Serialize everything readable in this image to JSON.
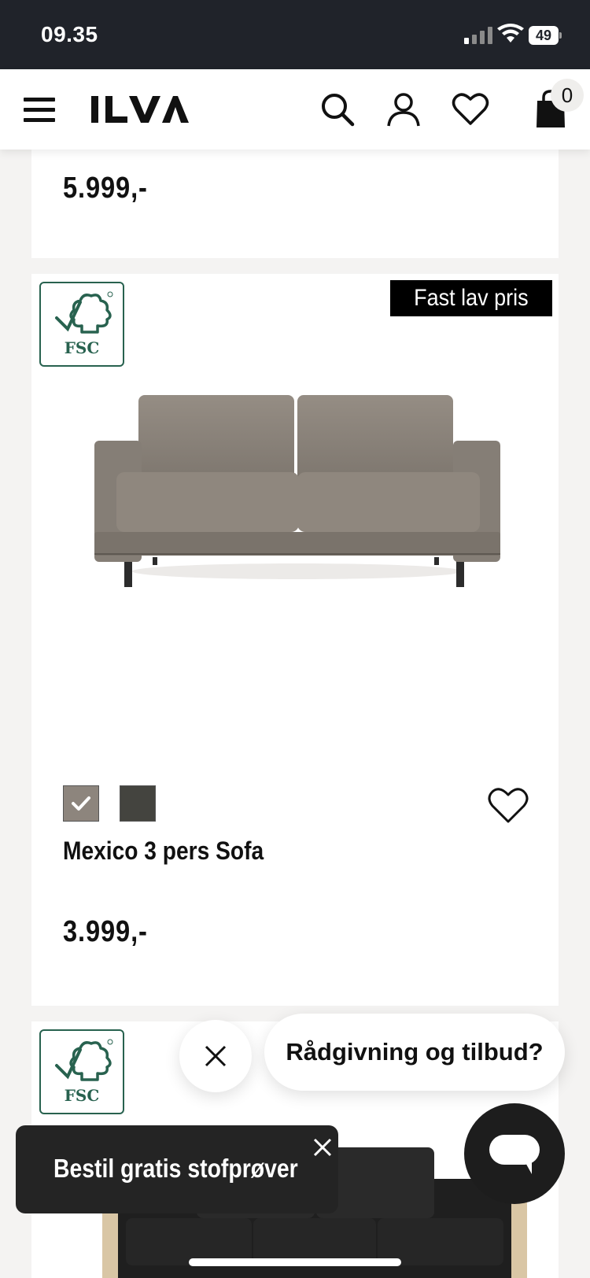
{
  "status_bar": {
    "time": "09.35",
    "battery": "49"
  },
  "header": {
    "logo_text": "ILVA",
    "icons": [
      "menu-icon",
      "search-icon",
      "user-icon",
      "heart-icon",
      "shopping-bag-icon"
    ],
    "cart_count": "0"
  },
  "products": [
    {
      "price": "5.999,-"
    },
    {
      "badge": "Fast lav pris",
      "certification": "FSC",
      "name": "Mexico 3 pers Sofa",
      "price": "3.999,-",
      "swatches": [
        {
          "color": "#8d857d",
          "selected": true
        },
        {
          "color": "#44443f",
          "selected": false
        }
      ]
    },
    {
      "certification": "FSC"
    }
  ],
  "chat": {
    "prompt": "Rådgivning og tilbud?"
  },
  "toast": {
    "text": "Bestil gratis stofprøver"
  },
  "colors": {
    "header_bg": "#ffffff",
    "status_bg": "#20232a",
    "fsc_green": "#28624f",
    "badge_bg": "#000000"
  }
}
